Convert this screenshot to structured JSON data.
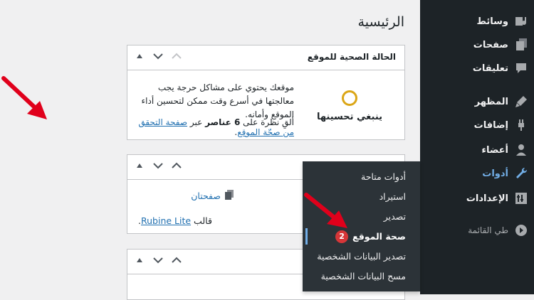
{
  "page": {
    "title": "الرئيسية"
  },
  "sidebar": {
    "items": [
      {
        "label": "وسائط",
        "icon": "media-icon"
      },
      {
        "label": "صفحات",
        "icon": "pages-icon"
      },
      {
        "label": "تعليقات",
        "icon": "comments-icon"
      },
      {
        "label": "المظهر",
        "icon": "appearance-icon"
      },
      {
        "label": "إضافات",
        "icon": "plugins-icon"
      },
      {
        "label": "أعضاء",
        "icon": "users-icon"
      },
      {
        "label": "أدوات",
        "icon": "tools-icon",
        "active": true
      },
      {
        "label": "الإعدادات",
        "icon": "settings-icon"
      },
      {
        "label": "طي القائمة",
        "icon": "collapse-icon"
      }
    ]
  },
  "submenu": {
    "items": [
      {
        "label": "أدوات متاحة"
      },
      {
        "label": "استيراد"
      },
      {
        "label": "تصدير"
      },
      {
        "label": "صحة الموقع",
        "badge": "2",
        "current": true
      },
      {
        "label": "تصدير البيانات الشخصية"
      },
      {
        "label": "مسح البيانات الشخصية"
      }
    ]
  },
  "site_health_widget": {
    "title": "الحالة الصحية للموقع",
    "status": "ينبغي تحسينها",
    "description": "موقعك يحتوي على مشاكل حرجة يجب معالجتها في أسرع وقت ممكن لتحسين أداء الموقع وأمانه.",
    "link_prefix": "ألقِ نظرة على",
    "count_text": "6 عناصر",
    "link_mid": "عبر",
    "link_text": "صفحة التحقق من صحّة الموقع",
    "link_suffix": "."
  },
  "glance_widget": {
    "pages_label": "صفحتان",
    "theme_prefix": "قالب",
    "theme_name": "Rubine Lite",
    "theme_suffix": "."
  },
  "colors": {
    "sidebar_bg": "#1d2327",
    "submenu_bg": "#2c3338",
    "accent": "#72aee6",
    "link": "#2271b1",
    "badge": "#d63638",
    "status_ring": "#dba617",
    "arrow": "#e0001b"
  }
}
